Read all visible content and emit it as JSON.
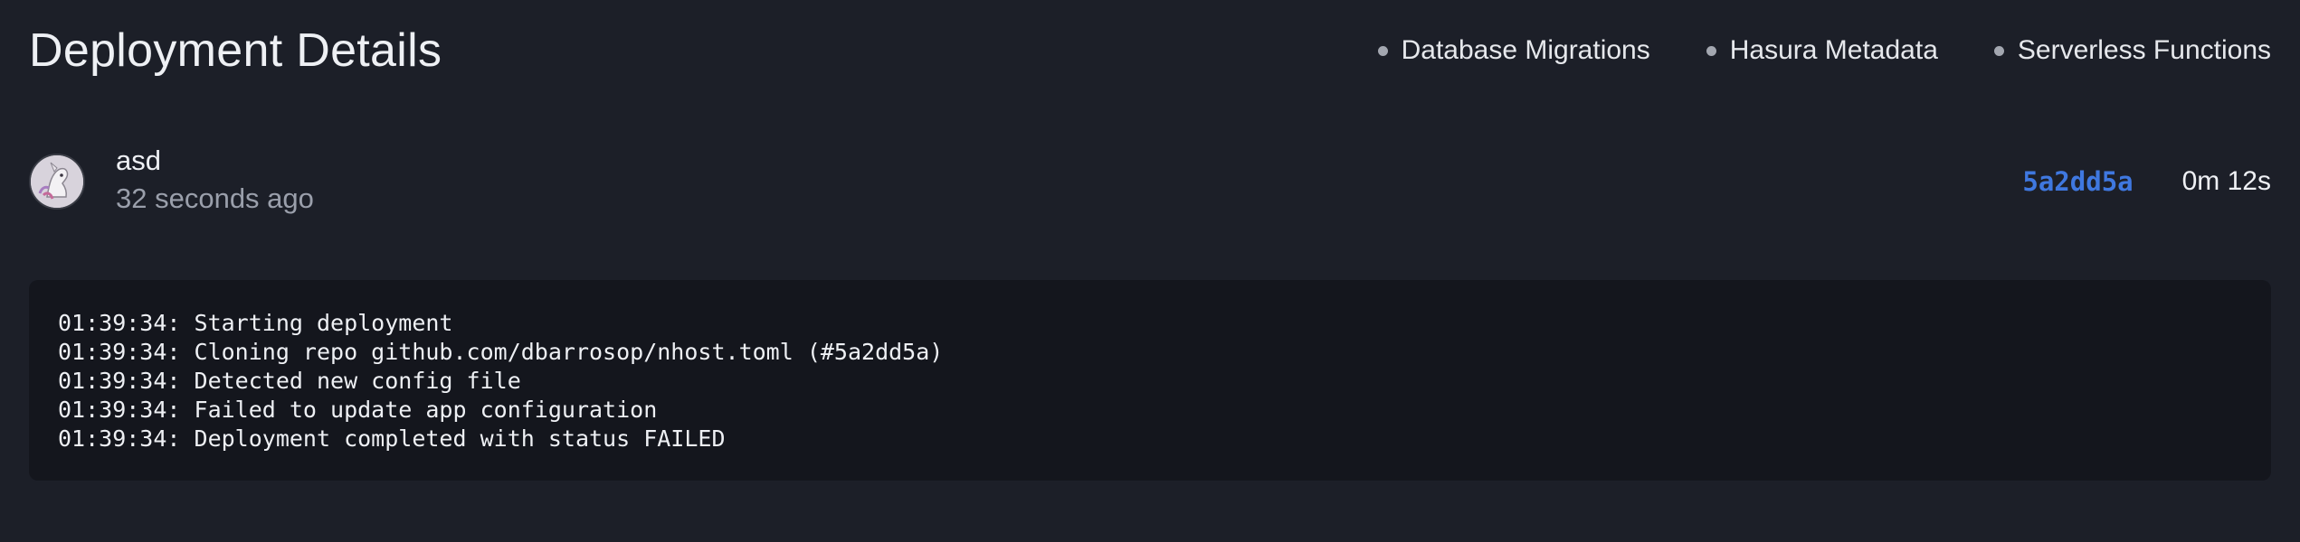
{
  "page": {
    "title": "Deployment Details"
  },
  "status_items": [
    {
      "label": "Database Migrations",
      "status": "pending"
    },
    {
      "label": "Hasura Metadata",
      "status": "pending"
    },
    {
      "label": "Serverless Functions",
      "status": "pending"
    }
  ],
  "deployment": {
    "author_name": "asd",
    "time_ago": "32 seconds ago",
    "commit": "5a2dd5a",
    "duration": "0m 12s"
  },
  "logs": [
    "01:39:34: Starting deployment",
    "01:39:34: Cloning repo github.com/dbarrosop/nhost.toml (#5a2dd5a)",
    "01:39:34: Detected new config file",
    "01:39:34: Failed to update app configuration",
    "01:39:34: Deployment completed with status FAILED"
  ],
  "colors": {
    "background": "#1c1f28",
    "log_background": "#14161d",
    "commit_link": "#3f78e0",
    "status_dot": "#a3a7b0",
    "muted_text": "#9a9fab"
  },
  "icons": {
    "status_dot": "status-dot-icon",
    "avatar": "user-avatar"
  }
}
